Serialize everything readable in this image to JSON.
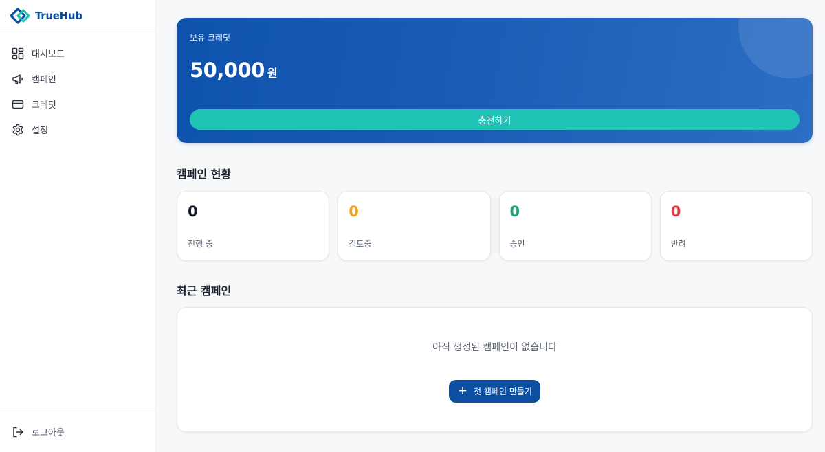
{
  "brand": {
    "name": "TrueHub"
  },
  "sidebar": {
    "items": [
      {
        "label": "대시보드",
        "icon": "dashboard-icon"
      },
      {
        "label": "캠페인",
        "icon": "megaphone-icon"
      },
      {
        "label": "크레딧",
        "icon": "credit-card-icon"
      },
      {
        "label": "설정",
        "icon": "gear-icon"
      }
    ],
    "logout_label": "로그아웃"
  },
  "credit": {
    "label": "보유 크레딧",
    "amount": "50,000",
    "unit": "원",
    "charge_label": "충전하기"
  },
  "campaign_status": {
    "title": "캠페인 현황",
    "stats": [
      {
        "value": "0",
        "label": "진행 중",
        "color": "#111827"
      },
      {
        "value": "0",
        "label": "검토중",
        "color": "#f4a21a"
      },
      {
        "value": "0",
        "label": "승인",
        "color": "#1aa86e"
      },
      {
        "value": "0",
        "label": "반려",
        "color": "#e63946"
      }
    ]
  },
  "recent": {
    "title": "최근 캠페인",
    "empty_text": "아직 생성된 캠페인이 없습니다",
    "create_label": "첫 캠페인 만들기"
  },
  "colors": {
    "primary": "#0b4ea2",
    "accent": "#1fc4b6"
  }
}
